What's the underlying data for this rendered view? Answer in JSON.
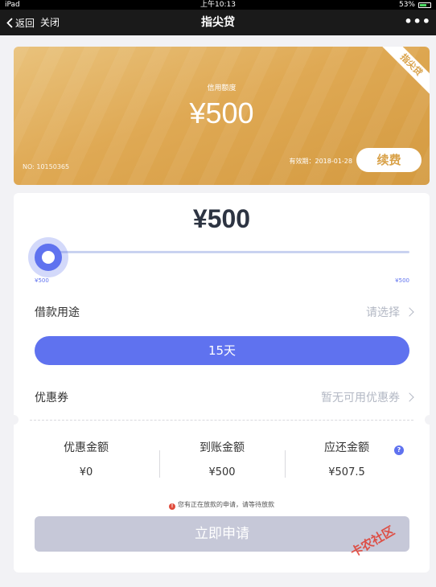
{
  "status": {
    "device": "iPad",
    "time": "上午10:13",
    "battery": "53%"
  },
  "nav": {
    "back": "返回",
    "close": "关闭",
    "title": "指尖贷",
    "more": "•••"
  },
  "card": {
    "ribbon": "指尖贷",
    "label": "信用额度",
    "amount": "¥500",
    "number": "NO: 10150365",
    "validity": "有效期：2018-01-28",
    "renew": "续费"
  },
  "loan": {
    "amount": "¥500",
    "slider": {
      "min": "¥500",
      "max": "¥500",
      "level": 0
    },
    "purpose_label": "借款用途",
    "purpose_value": "请选择",
    "term": "15天",
    "coupon_label": "优惠券",
    "coupon_value": "暂无可用优惠券"
  },
  "summary": [
    {
      "title": "优惠金额",
      "value": "¥0"
    },
    {
      "title": "到账金额",
      "value": "¥500"
    },
    {
      "title": "应还金额",
      "value": "¥507.5"
    }
  ],
  "help": "?",
  "notice_icon": "!",
  "notice": "您有正在放款的申请，请等待放款",
  "apply": "立即申请",
  "watermark": "卡农社区",
  "colors": {
    "accent": "#5f72ef",
    "gold": "#dfa954",
    "disabled": "#c6c8d8"
  }
}
